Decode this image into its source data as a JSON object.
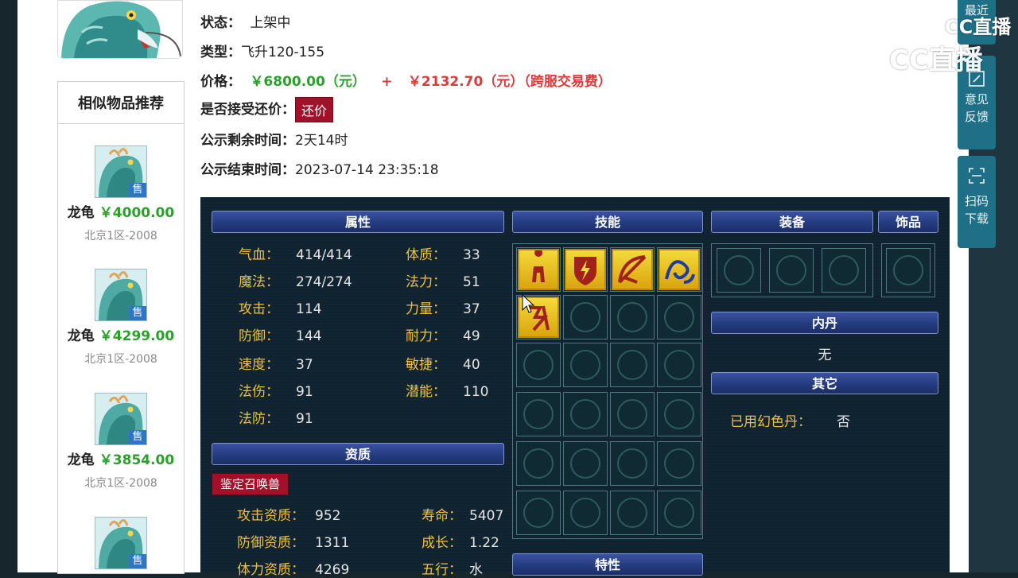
{
  "info": {
    "status_key": "状态：",
    "status_val": "上架中",
    "type_key": "类型：",
    "type_val": "飞升120-155",
    "price_key": "价格：",
    "price_main": "￥6800.00（元）",
    "price_plus": "+",
    "price_fee": "￥2132.70（元）（跨服交易费）",
    "counter_key": "是否接受还价：",
    "counter_btn": "还价",
    "remain_key": "公示剩余时间：",
    "remain_val": "2天14时",
    "end_key": "公示结束时间：",
    "end_val": "2023-07-14 23:35:18"
  },
  "recommend": {
    "title": "相似物品推荐",
    "sale_tag": "售",
    "items": [
      {
        "name": "龙龟",
        "price": "￥4000.00",
        "server": "北京1区-2008"
      },
      {
        "name": "龙龟",
        "price": "￥4299.00",
        "server": "北京1区-2008"
      },
      {
        "name": "龙龟",
        "price": "￥3854.00",
        "server": "北京1区-2008"
      },
      {
        "name": "",
        "price": "",
        "server": ""
      }
    ]
  },
  "side": {
    "recent": "最近",
    "feedback_1": "意见",
    "feedback_2": "反馈",
    "scan_1": "扫码",
    "scan_2": "下载"
  },
  "watermark": {
    "top": "CC直播",
    "main": "CC直播"
  },
  "panel": {
    "headers": {
      "attributes": "属性",
      "skills": "技能",
      "equipment": "装备",
      "accessory": "饰品",
      "neidan": "内丹",
      "other": "其它",
      "aptitude": "资质",
      "traits": "特性"
    },
    "attrs_left": [
      {
        "k": "气血：",
        "v": "414/414"
      },
      {
        "k": "魔法：",
        "v": "274/274"
      },
      {
        "k": "攻击：",
        "v": "114"
      },
      {
        "k": "防御：",
        "v": "144"
      },
      {
        "k": "速度：",
        "v": "37"
      },
      {
        "k": "法伤：",
        "v": "91"
      },
      {
        "k": "法防：",
        "v": "91"
      }
    ],
    "attrs_right": [
      {
        "k": "体质：",
        "v": "33"
      },
      {
        "k": "法力：",
        "v": "51"
      },
      {
        "k": "力量：",
        "v": "37"
      },
      {
        "k": "耐力：",
        "v": "49"
      },
      {
        "k": "敏捷：",
        "v": "40"
      },
      {
        "k": "潜能：",
        "v": "110"
      }
    ],
    "appraise_btn": "鉴定召唤兽",
    "aptitude_left": [
      {
        "k": "攻击资质：",
        "v": "952"
      },
      {
        "k": "防御资质：",
        "v": "1311"
      },
      {
        "k": "体力资质：",
        "v": "4269"
      }
    ],
    "aptitude_right": [
      {
        "k": "寿命：",
        "v": "5407"
      },
      {
        "k": "成长：",
        "v": "1.22"
      },
      {
        "k": "五行：",
        "v": "水"
      }
    ],
    "neidan_val": "无",
    "other_key": "已用幻色丹：",
    "other_val": "否",
    "skill_icons": [
      "figure-skill-icon",
      "shield-skill-icon",
      "bow-skill-icon",
      "wave-skill-icon",
      "rune-skill-icon"
    ]
  },
  "colors": {
    "label_gold": "#f0c23a",
    "price_green": "#2aa12a",
    "price_red": "#e0393a",
    "button_red": "#a3102a",
    "panel_bg": "#0f2230",
    "header_blue": "#233a7c"
  }
}
